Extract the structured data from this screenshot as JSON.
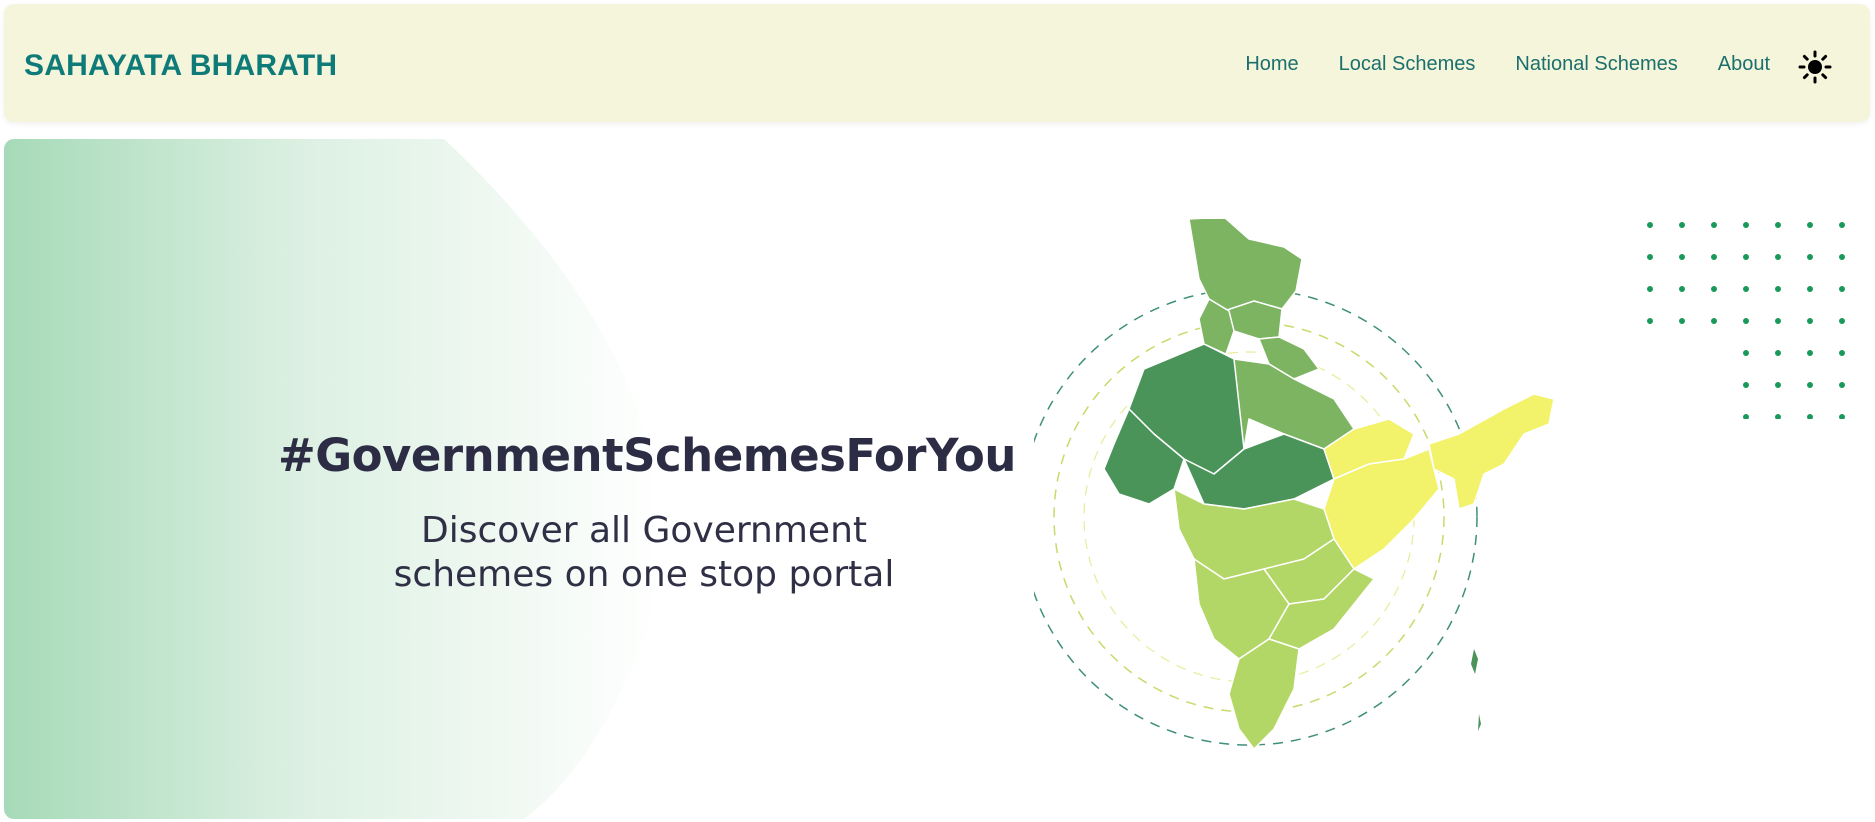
{
  "navbar": {
    "brand": "SAHAYATA BHARATH",
    "links": [
      "Home",
      "Local Schemes",
      "National Schemes",
      "About"
    ],
    "theme_icon": "sun-icon"
  },
  "hero": {
    "heading": "#GovernmentSchemesForYou",
    "subtitle_line1": "Discover all Government",
    "subtitle_line2": "schemes on one stop portal",
    "image": "india-map-illustration"
  },
  "colors": {
    "brand": "#0f7b78",
    "nav_bg": "#f5f5dc",
    "gradient_green": "#a8dcb8",
    "map_dark": "#4a9459",
    "map_mid": "#7cb462",
    "map_light": "#b3d766",
    "map_yellow": "#f2f26b",
    "dots": "#1a9a5a"
  }
}
